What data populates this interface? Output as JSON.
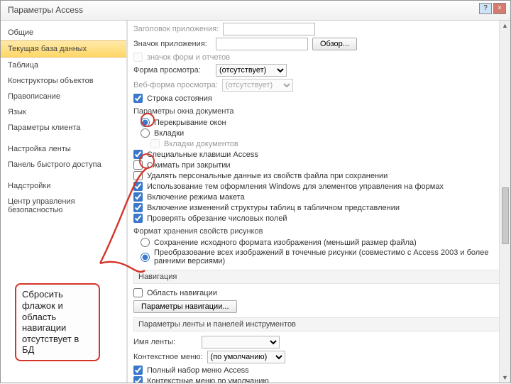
{
  "window": {
    "title": "Параметры Access"
  },
  "sidebar": {
    "items": [
      {
        "label": "Общие"
      },
      {
        "label": "Текущая база данных"
      },
      {
        "label": "Таблица"
      },
      {
        "label": "Конструкторы объектов"
      },
      {
        "label": "Правописание"
      },
      {
        "label": "Язык"
      },
      {
        "label": "Параметры клиента"
      },
      {
        "label": "Настройка ленты"
      },
      {
        "label": "Панель быстрого доступа"
      },
      {
        "label": "Надстройки"
      },
      {
        "label": "Центр управления безопасностью"
      }
    ],
    "active_index": 1
  },
  "top": {
    "app_title_label": "Заголовок приложения:",
    "app_icon_label": "Значок приложения:",
    "browse": "Обзор...",
    "icon_forms_reports": "значок форм и отчетов",
    "display_form_label": "Форма просмотра:",
    "display_form_value": "(отсутствует)",
    "web_form_label": "Веб-форма просмотра:",
    "web_form_value": "(отсутствует)",
    "status_bar": "Строка состояния"
  },
  "docwin": {
    "header": "Параметры окна документа",
    "overlap": "Перекрывание окон",
    "tabs": "Вкладки",
    "tabs_docs": "Вкладки документов"
  },
  "opts": {
    "special_keys": "Специальные клавиши Access",
    "compact": "Сжимать при закрытии",
    "remove_personal": "Удалять персональные данные из свойств файла при сохранении",
    "themed_controls": "Использование тем оформления Windows для элементов управления на формах",
    "layout_view": "Включение режима макета",
    "design_changes": "Включение изменений структуры таблиц в табличном представлении",
    "check_truncated": "Проверять обрезание числовых полей"
  },
  "picfmt": {
    "header": "Формат хранения свойств рисунков",
    "keep_source": "Сохранение исходного формата изображения (меньший размер файла)",
    "convert_all": "Преобразование всех изображений в точечные рисунки (совместимо с Access 2003 и более ранними версиями)"
  },
  "nav": {
    "header": "Навигация",
    "show_nav": "Область навигации",
    "options_btn": "Параметры навигации..."
  },
  "ribbon": {
    "header": "Параметры ленты и панелей инструментов",
    "ribbon_name": "Имя ленты:",
    "ctx_menu": "Контекстное меню:",
    "ctx_menu_value": "(по умолчанию)",
    "full_menus": "Полный набор меню Access",
    "ctx_default": "Контекстные меню по умолчанию"
  },
  "callout": "Сбросить флажок и область навигации отсутствует в БД"
}
